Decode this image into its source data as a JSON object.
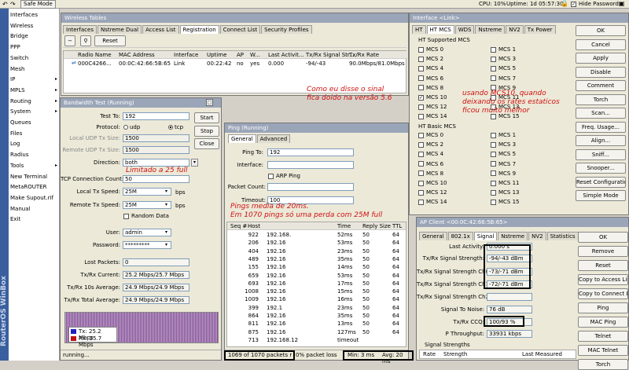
{
  "topbar": {
    "safe_mode": "Safe Mode",
    "cpu": "CPU: 10%",
    "uptime": "Uptime: 1d 05:57:30",
    "hide_passwords": "Hide Passwords"
  },
  "sidebar": {
    "vertical_label": "RouterOS WinBox",
    "items": [
      "Interfaces",
      "Wireless",
      "Bridge",
      "PPP",
      "Switch",
      "Mesh",
      "IP",
      "MPLS",
      "Routing",
      "System",
      "Queues",
      "Files",
      "Log",
      "Radius",
      "Tools",
      "New Terminal",
      "MetaROUTER",
      "Make Supout.rif",
      "Manual",
      "Exit"
    ]
  },
  "wireless": {
    "title": "Wireless Tables",
    "tabs": [
      "Interfaces",
      "Nstreme Dual",
      "Access List",
      "Registration",
      "Connect List",
      "Security Profiles"
    ],
    "reset": "Reset",
    "headers": [
      "Radio Name",
      "MAC Address",
      "Interface",
      "Uptime",
      "AP",
      "W...",
      "Last Activit...",
      "Tx/Rx Signal Str...",
      "Tx/Rx Rate"
    ],
    "row": [
      "000C4266...",
      "00:0C:42:66:5B:65",
      "Link",
      "00:22:42",
      "no",
      "yes",
      "0.000",
      "-94/-43",
      "90.0Mbps/81.0Mbps"
    ]
  },
  "bandwidth": {
    "title": "Bandwidth Test (Running)",
    "test_to_label": "Test To:",
    "test_to": "192",
    "protocol_label": "Protocol:",
    "udp": "udp",
    "tcp": "tcp",
    "local_udp_label": "Local UDP Tx Size:",
    "local_udp": "1500",
    "remote_udp_label": "Remote UDP Tx Size:",
    "remote_udp": "1500",
    "direction_label": "Direction:",
    "direction": "both",
    "tcp_conn_label": "TCP Connection Count:",
    "tcp_conn": "50",
    "local_speed_label": "Local Tx Speed:",
    "local_speed": "25M",
    "remote_speed_label": "Remote Tx Speed:",
    "remote_speed": "25M",
    "bps": "bps",
    "random_data": "Random Data",
    "user_label": "User:",
    "user": "admin",
    "password_label": "Password:",
    "password": "*********",
    "lost_label": "Lost Packets:",
    "lost": "0",
    "current_label": "Tx/Rx Current:",
    "current": "25.2 Mbps/25.7 Mbps",
    "avg10_label": "Tx/Rx 10s Average:",
    "avg10": "24.9 Mbps/24.9 Mbps",
    "total_label": "Tx/Rx Total Average:",
    "total": "24.9 Mbps/24.9 Mbps",
    "legend_tx": "Tx:  25.2 Mbps",
    "legend_rx": "Rx:  25.7 Mbps",
    "start": "Start",
    "stop": "Stop",
    "close": "Close",
    "status": "running..."
  },
  "ping": {
    "title": "Ping (Running)",
    "tabs": [
      "General",
      "Advanced"
    ],
    "ping_to_label": "Ping To:",
    "ping_to": "192",
    "interface_label": "Interface:",
    "arp": "ARP Ping",
    "count_label": "Packet Count:",
    "timeout_label": "Timeout:",
    "timeout": "100",
    "headers": [
      "Seq #",
      "Host",
      "Time",
      "Reply Size",
      "TTL"
    ],
    "rows": [
      [
        "922",
        "192.168.",
        "52ms",
        "50",
        "64"
      ],
      [
        "206",
        "192.16",
        "53ms",
        "50",
        "64"
      ],
      [
        "404",
        "192.16",
        "23ms",
        "50",
        "64"
      ],
      [
        "489",
        "192.16",
        "35ms",
        "50",
        "64"
      ],
      [
        "155",
        "192.16",
        "14ms",
        "50",
        "64"
      ],
      [
        "659",
        "192.16",
        "53ms",
        "50",
        "64"
      ],
      [
        "693",
        "192.16",
        "17ms",
        "50",
        "64"
      ],
      [
        "1008",
        "192.16",
        "15ms",
        "50",
        "64"
      ],
      [
        "1009",
        "192.16",
        "16ms",
        "50",
        "64"
      ],
      [
        "399",
        "192.1",
        "23ms",
        "50",
        "64"
      ],
      [
        "864",
        "192.16",
        "35ms",
        "50",
        "64"
      ],
      [
        "811",
        "192.16",
        "13ms",
        "50",
        "64"
      ],
      [
        "875",
        "192.16",
        "127ms",
        "50",
        "64"
      ],
      [
        "713",
        "192.168.12",
        "timeout",
        "",
        ""
      ]
    ],
    "status_packets": "1069 of 1070 packets r",
    "status_loss": "0% packet loss",
    "status_min": "Min: 3 ms",
    "status_avg": "Avg: 20 ms"
  },
  "iface": {
    "title": "Interface <Link>",
    "tabs": [
      "HT",
      "HT MCS",
      "WDS",
      "Nstreme",
      "NV2",
      "Tx Power"
    ],
    "ht_supported": "HT Supported MCS",
    "ht_basic": "HT Basic MCS",
    "supported_left": [
      "MCS 0",
      "MCS 2",
      "MCS 4",
      "MCS 6",
      "MCS 8",
      "MCS 10",
      "MCS 12",
      "MCS 14"
    ],
    "supported_right": [
      "MCS 1",
      "MCS 3",
      "MCS 5",
      "MCS 7",
      "MCS 9",
      "MCS 11",
      "MCS 13",
      "MCS 15"
    ],
    "basic_left": [
      "MCS 0",
      "MCS 2",
      "MCS 4",
      "MCS 6",
      "MCS 8",
      "MCS 10",
      "MCS 12",
      "MCS 14"
    ],
    "basic_right": [
      "MCS 1",
      "MCS 3",
      "MCS 5",
      "MCS 7",
      "MCS 9",
      "MCS 11",
      "MCS 13",
      "MCS 15"
    ],
    "buttons": [
      "OK",
      "Cancel",
      "Apply",
      "Disable",
      "Comment",
      "Torch",
      "Scan...",
      "Freq. Usage...",
      "Align...",
      "Sniff...",
      "Snooper...",
      "Reset Configuration",
      "Simple Mode"
    ]
  },
  "apclient": {
    "title": "AP Client <00:0C:42:66:5B:65>",
    "tabs": [
      "General",
      "802.1x",
      "Signal",
      "Nstreme",
      "NV2",
      "Statistics"
    ],
    "last_activity_label": "Last Activity:",
    "last_activity": "0.000 s",
    "strength_label": "Tx/Rx Signal Strength:",
    "strength": "-94/-43 dBm",
    "ch0_label": "Tx/Rx Signal Strength Ch0:",
    "ch0": "-73/-71 dBm",
    "ch1_label": "Tx/Rx Signal Strength Ch1:",
    "ch1": "-72/-71 dBm",
    "ch2_label": "Tx/Rx Signal Strength Ch2:",
    "ch2": "",
    "snr_label": "Signal To Noise:",
    "snr": "76 dB",
    "ccq_label": "Tx/Rx CCQ:",
    "ccq": "100/93 %",
    "pthr_label": "P Throughput:",
    "pthr": "33931 kbps",
    "strengths": "Signal Strengths",
    "sh": [
      "Rate",
      "Strength",
      "Last Measured"
    ],
    "buttons": [
      "OK",
      "Remove",
      "Reset",
      "Copy to Access List",
      "Copy to Connect List",
      "Ping",
      "MAC Ping",
      "Telnet",
      "MAC Telnet",
      "Torch"
    ]
  },
  "notes": {
    "n1a": "Como eu disse o sinal",
    "n1b": "fica doido na versão 5.6",
    "n2a": "usando MCS10, quando",
    "n2b": "deixando os rates estaticos",
    "n2c": "ficou muito melhor",
    "n3": "Limitado a 25 full",
    "n4a": "Pings media de 20ms.",
    "n4b": "Em 1070 pings só uma perda com 25M full"
  }
}
